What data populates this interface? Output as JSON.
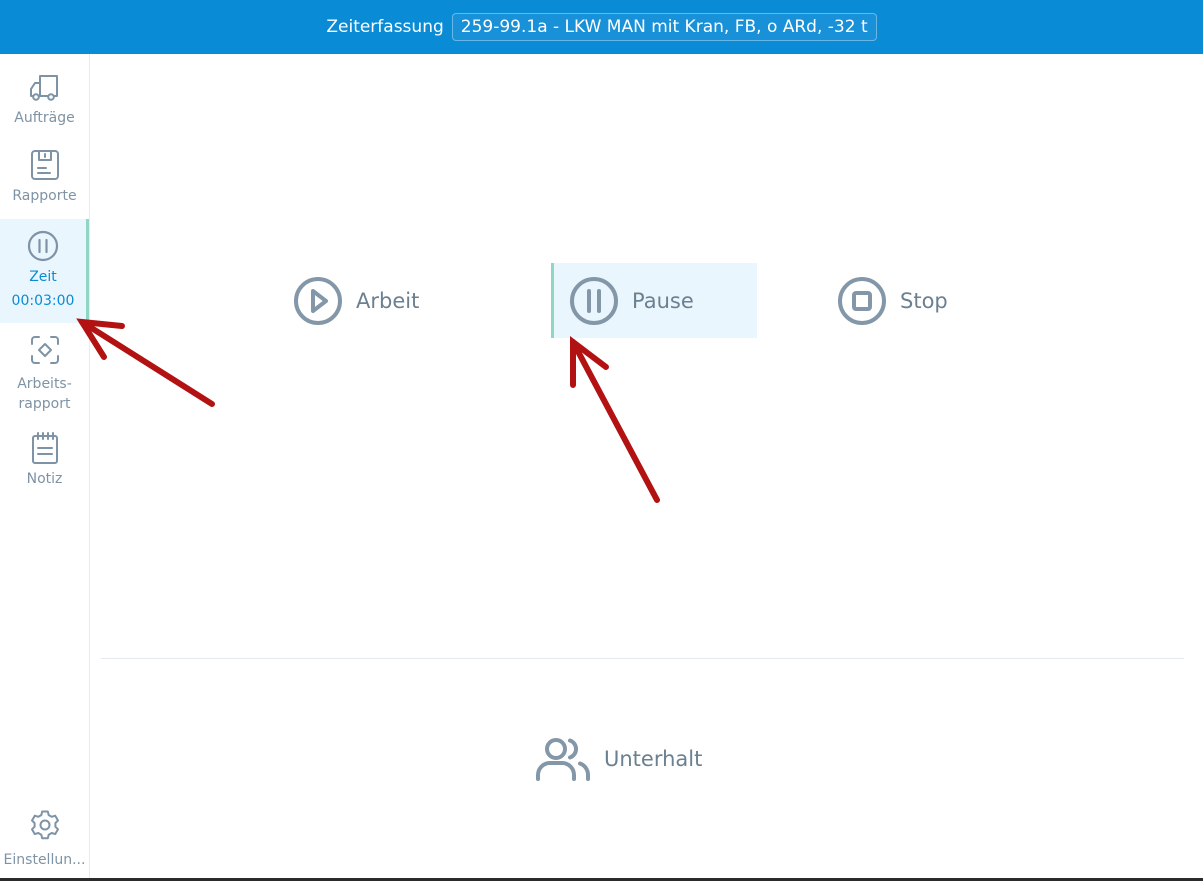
{
  "header": {
    "title": "Zeiterfassung",
    "vehicle": "259-99.1a - LKW MAN mit Kran, FB, o ARd, -32 t"
  },
  "sidebar": {
    "items": [
      {
        "label": "Aufträge",
        "icon": "truck-icon"
      },
      {
        "label": "Rapporte",
        "icon": "clipboard-icon"
      },
      {
        "label": "Zeit",
        "icon": "pause-circle-icon",
        "timer": "00:03:00",
        "active": true
      },
      {
        "label": "Arbeits-",
        "label2": "rapport",
        "icon": "target-icon"
      },
      {
        "label": "Notiz",
        "icon": "notepad-icon"
      }
    ],
    "settings_label": "Einstellun..."
  },
  "actions": {
    "work": "Arbeit",
    "pause": "Pause",
    "stop": "Stop",
    "maintenance": "Unterhalt"
  },
  "colors": {
    "header": "#0a8bd6",
    "active_bg": "#eaf6fd",
    "active_border": "#8fd6c5",
    "icon": "#7e93a5",
    "annotation_arrow": "#b31212"
  }
}
